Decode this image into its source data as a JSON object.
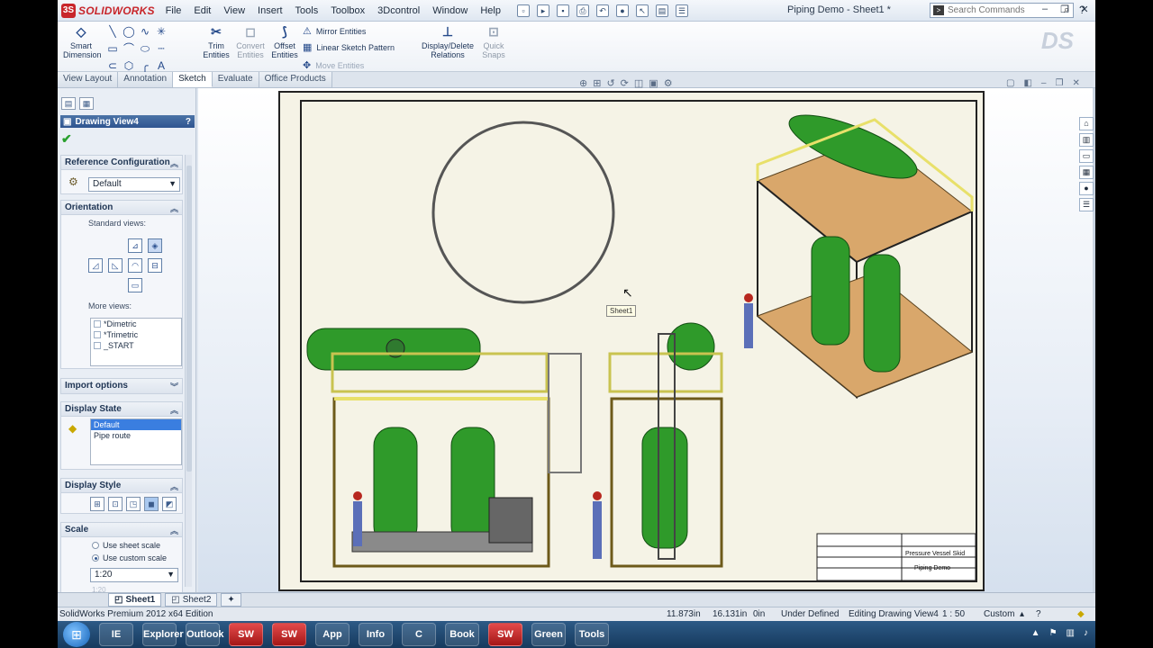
{
  "app": {
    "brand_prefix": "3S",
    "brand": "SOLIDWORKS",
    "doc_title": "Piping Demo - Sheet1 *"
  },
  "menus": [
    "File",
    "Edit",
    "View",
    "Insert",
    "Tools",
    "Toolbox",
    "3Dcontrol",
    "Window",
    "Help"
  ],
  "search": {
    "placeholder": "Search Commands"
  },
  "commands": {
    "smart_dimension": "Smart Dimension",
    "trim": "Trim Entities",
    "convert": "Convert Entities",
    "offset": "Offset Entities",
    "mirror": "Mirror Entities",
    "linear_pattern": "Linear Sketch Pattern",
    "move": "Move Entities",
    "relations": "Display/Delete Relations",
    "quick_snaps": "Quick Snaps"
  },
  "tabs": [
    "View Layout",
    "Annotation",
    "Sketch",
    "Evaluate",
    "Office Products"
  ],
  "active_tab": "Sketch",
  "property_manager": {
    "title": "Drawing View4",
    "reference_config": {
      "header": "Reference Configuration",
      "value": "Default"
    },
    "orientation": {
      "header": "Orientation",
      "standard_views": "Standard views:",
      "more_views": "More views:",
      "more_items": [
        "*Dimetric",
        "*Trimetric",
        "_START"
      ]
    },
    "import_options": {
      "header": "Import options"
    },
    "display_state": {
      "header": "Display State",
      "items": [
        "Default",
        "Pipe route"
      ],
      "selected": "Default"
    },
    "display_style": {
      "header": "Display Style"
    },
    "scale": {
      "header": "Scale",
      "use_sheet": "Use sheet scale",
      "use_custom": "Use custom scale",
      "value": "1:20",
      "ghost_value": "1:20"
    }
  },
  "graphics": {
    "view_tooltip": "Sheet1",
    "title_block": {
      "description": "Pressure Vessel Skid",
      "drawing_name": "Piping Demo"
    }
  },
  "sheet_tabs": [
    "Sheet1",
    "Sheet2"
  ],
  "active_sheet": "Sheet1",
  "status": {
    "edition": "SolidWorks Premium 2012 x64 Edition",
    "x": "11.873in",
    "y": "16.131in",
    "z": "0in",
    "definition": "Under Defined",
    "editing": "Editing Drawing View4",
    "scale": "1 : 50",
    "units": "Custom"
  },
  "colors": {
    "accent": "#2f5590",
    "brand": "#c8262b",
    "equipment_green": "#2f9a2a",
    "structure_yellow": "#e8e06a",
    "deck_tan": "#d9a76b"
  },
  "taskbar": {
    "apps": [
      "IE",
      "Explorer",
      "Outlook",
      "SW",
      "SW",
      "App",
      "Info",
      "C",
      "Book",
      "SW",
      "Green",
      "Tools"
    ]
  }
}
